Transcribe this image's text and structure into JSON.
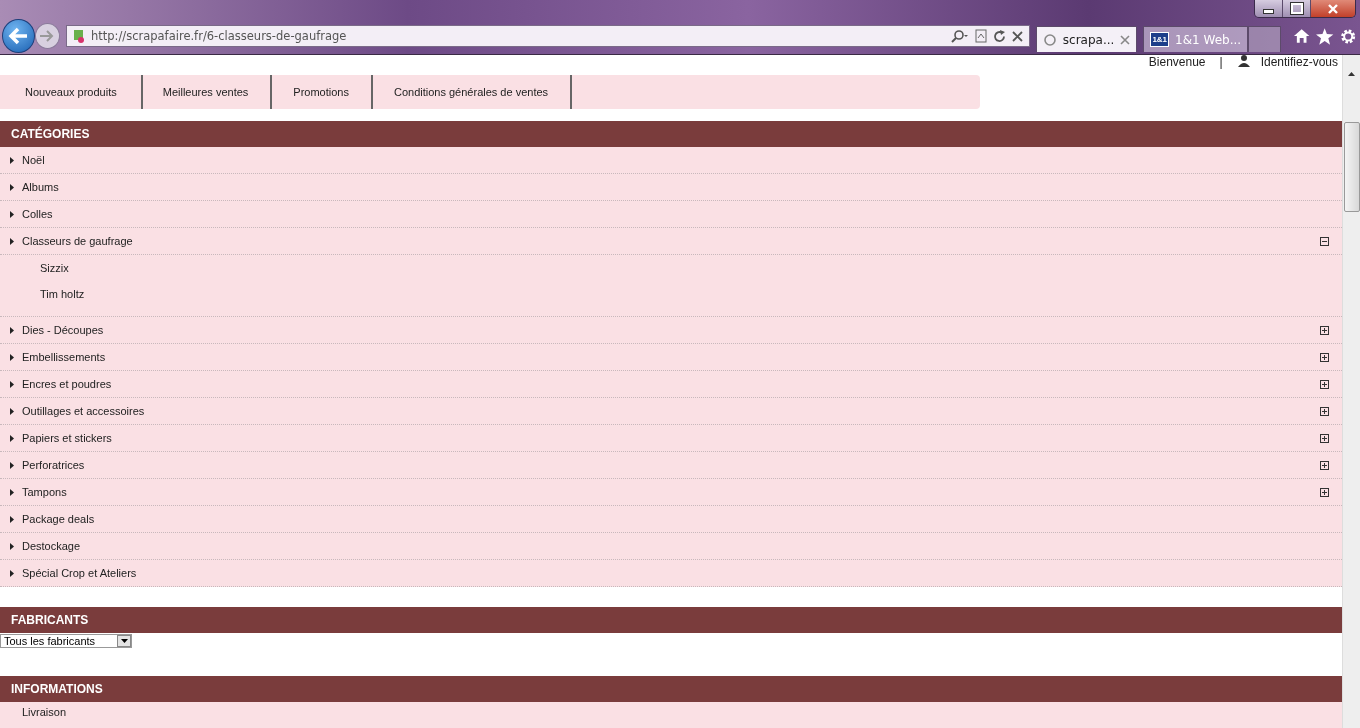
{
  "browser": {
    "address": "http://scrapafaire.fr/6-classeurs-de-gaufrage",
    "tabs": [
      {
        "label": "scrapa...",
        "selected": true,
        "kind": "loading"
      },
      {
        "label": "1&1 Web...",
        "selected": false,
        "kind": "site",
        "badge": "1&1"
      }
    ]
  },
  "header": {
    "welcome": "Bienvenue",
    "separator": "|",
    "login": "Identifiez-vous"
  },
  "menu": [
    "Nouveaux produits",
    "Meilleures ventes",
    "Promotions",
    "Conditions générales de ventes"
  ],
  "categories": {
    "title": "CATÉGORIES",
    "items": [
      {
        "label": "Noël"
      },
      {
        "label": "Albums"
      },
      {
        "label": "Colles"
      },
      {
        "label": "Classeurs de gaufrage",
        "expanded": true,
        "children": [
          "Sizzix",
          "Tim holtz"
        ]
      },
      {
        "label": "Dies - Découpes",
        "expanded": false
      },
      {
        "label": "Embellissements",
        "expanded": false
      },
      {
        "label": "Encres et poudres",
        "expanded": false
      },
      {
        "label": "Outillages et accessoires",
        "expanded": false
      },
      {
        "label": "Papiers et stickers",
        "expanded": false
      },
      {
        "label": "Perforatrices",
        "expanded": false
      },
      {
        "label": "Tampons",
        "expanded": false
      },
      {
        "label": "Package deals"
      },
      {
        "label": "Destockage"
      },
      {
        "label": "Spécial Crop et Ateliers"
      }
    ]
  },
  "manufacturers": {
    "title": "FABRICANTS",
    "select": "Tous les fabricants"
  },
  "informations": {
    "title": "INFORMATIONS",
    "items": [
      "Livraison"
    ]
  }
}
